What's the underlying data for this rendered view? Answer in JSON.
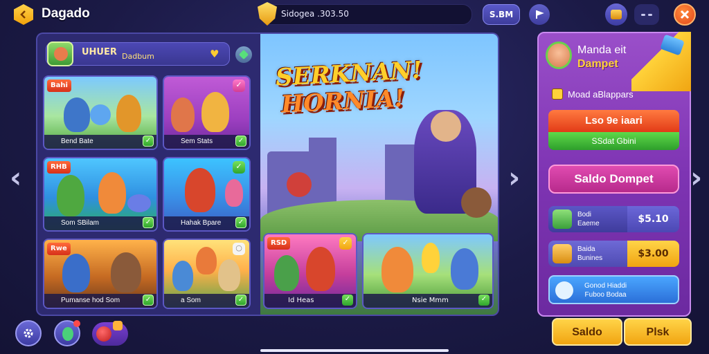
{
  "header": {
    "title": "Dagado",
    "coin_value": "Sidogea .303.50",
    "price_label": "S.BM"
  },
  "user": {
    "name": "UHUER",
    "subtitle": "Dadbum"
  },
  "cards": [
    {
      "label": "Bend Bate",
      "tag": "Bahi"
    },
    {
      "label": "Sem Stats"
    },
    {
      "label": "Som SBilam",
      "tag": "RHB"
    },
    {
      "label": "Hahak Bpare"
    },
    {
      "label": "Pumanse hod Som",
      "tag": "Rwe"
    },
    {
      "label": "a Som"
    },
    {
      "label": "Id Heas",
      "tag": "RSD"
    },
    {
      "label": "Nsie Mmm"
    }
  ],
  "banner": {
    "line1": "SERKNAN!",
    "line2": "HORNIA!"
  },
  "wallet": {
    "title_line1": "Manda eit",
    "title_line2": "Dampet",
    "note": "Moad aBlappars",
    "red_button": "Lso 9e iaari",
    "green_button": "SSdat Gbini",
    "saldo_button": "Saldo Dompet",
    "rows": [
      {
        "text_line1": "Bodi",
        "text_line2": "Eaeme",
        "value": "$5.10"
      },
      {
        "text_line1": "Baida",
        "text_line2": "Bunines",
        "value": "$3.00"
      }
    ],
    "blue_line1": "Gonod Hiaddi",
    "blue_line2": "Fuboo Bodaa"
  },
  "footer": {
    "saldo_button": "Saldo",
    "pick_button": "Plsk"
  },
  "colors": {
    "accent_gold": "#ffd448",
    "wallet_purple": "#8a3fbf",
    "close_red": "#e4471b",
    "check_green": "#2fa52c"
  }
}
